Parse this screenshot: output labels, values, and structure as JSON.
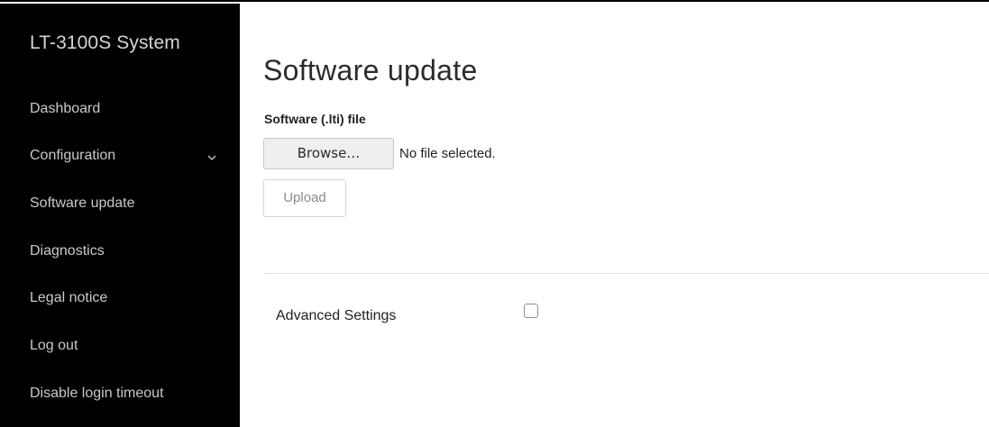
{
  "sidebar": {
    "brand": "LT-3100S System",
    "items": [
      {
        "label": "Dashboard"
      },
      {
        "label": "Configuration",
        "icon": "chevron-down-icon"
      },
      {
        "label": "Software update"
      },
      {
        "label": "Diagnostics"
      },
      {
        "label": "Legal notice"
      },
      {
        "label": "Log out"
      },
      {
        "label": "Disable login timeout"
      }
    ]
  },
  "main": {
    "title": "Software update",
    "file_field": {
      "label": "Software (.lti) file",
      "browse_label": "Browse…",
      "status": "No file selected."
    },
    "upload_label": "Upload",
    "advanced": {
      "label": "Advanced Settings",
      "checked": false
    }
  },
  "colors": {
    "sidebar_bg": "#000000",
    "sidebar_text": "#c9c9c9",
    "page_bg": "#ffffff"
  }
}
